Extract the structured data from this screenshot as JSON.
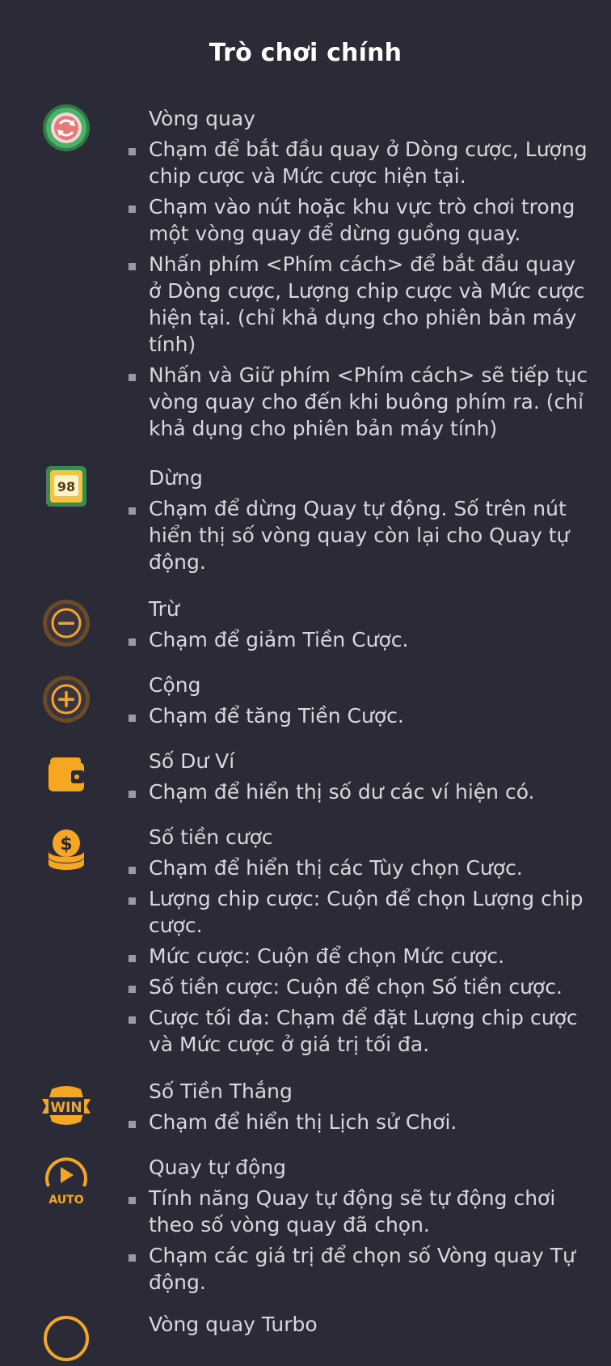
{
  "page": {
    "title": "Trò chơi chính"
  },
  "sections": [
    {
      "title": "Vòng quay",
      "icon": "spin-icon",
      "bullets": [
        "Chạm để bắt đầu quay ở Dòng cược, Lượng chip cược và Mức cược hiện tại.",
        "Chạm vào nút hoặc khu vực trò chơi trong một vòng quay để dừng guồng quay.",
        "Nhấn phím <Phím cách> để bắt đầu quay ở Dòng cược, Lượng chip cược và Mức cược hiện tại. (chỉ khả dụng cho phiên bản máy tính)",
        "Nhấn và Giữ phím <Phím cách> sẽ tiếp tục vòng quay cho đến khi buông phím ra. (chỉ khả dụng cho phiên bản máy tính)"
      ]
    },
    {
      "title": "Dừng",
      "icon": "stop-icon",
      "icon_text": "98",
      "bullets": [
        "Chạm để dừng Quay tự động. Số trên nút hiển thị số vòng quay còn lại cho Quay tự động."
      ]
    },
    {
      "title": "Trừ",
      "icon": "minus-icon",
      "bullets": [
        "Chạm để giảm Tiền Cược."
      ]
    },
    {
      "title": "Cộng",
      "icon": "plus-icon",
      "bullets": [
        "Chạm để tăng Tiền Cược."
      ]
    },
    {
      "title": "Số Dư Ví",
      "icon": "wallet-icon",
      "bullets": [
        "Chạm để hiển thị số dư các ví hiện có."
      ]
    },
    {
      "title": "Số tiền cược",
      "icon": "coins-icon",
      "bullets": [
        "Chạm để hiển thị các Tùy chọn Cược.",
        "Lượng chip cược: Cuộn để chọn Lượng chip cược.",
        "Mức cược: Cuộn để chọn Mức cược.",
        "Số tiền cược: Cuộn để chọn Số tiền cược.",
        "Cược tối đa: Chạm để đặt Lượng chip cược và Mức cược ở giá trị tối đa."
      ]
    },
    {
      "title": "Số Tiền Thắng",
      "icon": "win-icon",
      "icon_text": "WIN",
      "bullets": [
        "Chạm để hiển thị Lịch sử Chơi."
      ]
    },
    {
      "title": "Quay tự động",
      "icon": "autoplay-icon",
      "icon_text": "AUTO",
      "bullets": [
        "Tính năng Quay tự động sẽ tự động chơi theo số vòng quay đã chọn.",
        "Chạm các giá trị để chọn số Vòng quay Tự động."
      ]
    },
    {
      "title": "Vòng quay Turbo",
      "icon": "turbo-icon",
      "bullets": []
    }
  ],
  "colors": {
    "background": "#2b2b38",
    "text": "#d7d7de",
    "title": "#ffffff",
    "accent_gold": "#f5a623",
    "spin_green": "#3f9a55",
    "spin_red": "#e8797a"
  }
}
